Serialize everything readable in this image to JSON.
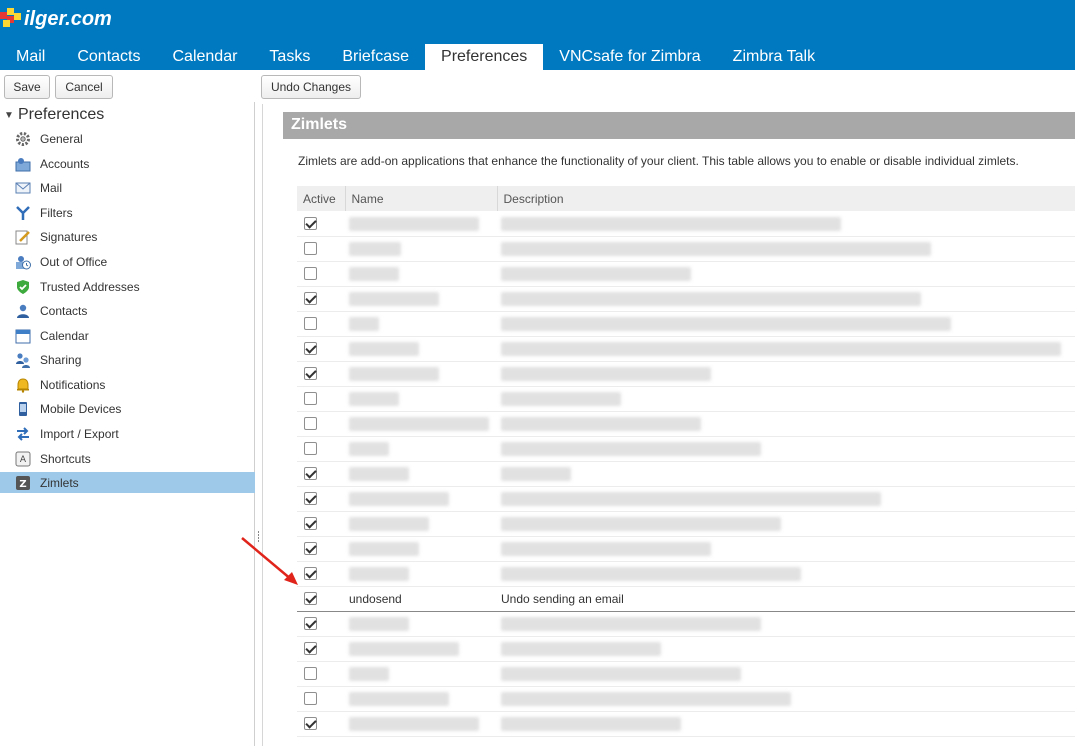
{
  "header": {
    "logo_text": "ilger.com",
    "tabs": [
      {
        "label": "Mail"
      },
      {
        "label": "Contacts"
      },
      {
        "label": "Calendar"
      },
      {
        "label": "Tasks"
      },
      {
        "label": "Briefcase"
      },
      {
        "label": "Preferences",
        "active": true
      },
      {
        "label": "VNCsafe for Zimbra"
      },
      {
        "label": "Zimbra Talk"
      }
    ]
  },
  "toolbar": {
    "save_label": "Save",
    "cancel_label": "Cancel",
    "undo_label": "Undo Changes"
  },
  "sidebar": {
    "title": "Preferences",
    "items": [
      {
        "label": "General",
        "icon": "gear-icon"
      },
      {
        "label": "Accounts",
        "icon": "accounts-icon"
      },
      {
        "label": "Mail",
        "icon": "envelope-icon"
      },
      {
        "label": "Filters",
        "icon": "filter-icon"
      },
      {
        "label": "Signatures",
        "icon": "signature-icon"
      },
      {
        "label": "Out of Office",
        "icon": "out-of-office-icon"
      },
      {
        "label": "Trusted Addresses",
        "icon": "shield-check-icon"
      },
      {
        "label": "Contacts",
        "icon": "contacts-icon"
      },
      {
        "label": "Calendar",
        "icon": "calendar-icon"
      },
      {
        "label": "Sharing",
        "icon": "sharing-icon"
      },
      {
        "label": "Notifications",
        "icon": "bell-icon"
      },
      {
        "label": "Mobile Devices",
        "icon": "mobile-icon"
      },
      {
        "label": "Import / Export",
        "icon": "import-export-icon"
      },
      {
        "label": "Shortcuts",
        "icon": "keyboard-icon"
      },
      {
        "label": "Zimlets",
        "icon": "zimlet-icon",
        "selected": true
      }
    ]
  },
  "main": {
    "section_title": "Zimlets",
    "intro": "Zimlets are add-on applications that enhance the functionality of your client. This table allows you to enable or disable individual zimlets.",
    "columns": [
      "Active",
      "Name",
      "Description"
    ],
    "rows": [
      {
        "active": true,
        "name": "",
        "description": ""
      },
      {
        "active": false,
        "name": "",
        "description": ""
      },
      {
        "active": false,
        "name": "",
        "description": ""
      },
      {
        "active": true,
        "name": "",
        "description": ""
      },
      {
        "active": false,
        "name": "",
        "description": ""
      },
      {
        "active": true,
        "name": "",
        "description": ""
      },
      {
        "active": true,
        "name": "",
        "description": ""
      },
      {
        "active": false,
        "name": "",
        "description": ""
      },
      {
        "active": false,
        "name": "",
        "description": ""
      },
      {
        "active": false,
        "name": "",
        "description": ""
      },
      {
        "active": true,
        "name": "",
        "description": ""
      },
      {
        "active": true,
        "name": "",
        "description": ""
      },
      {
        "active": true,
        "name": "",
        "description": ""
      },
      {
        "active": true,
        "name": "",
        "description": ""
      },
      {
        "active": true,
        "name": "",
        "description": ""
      },
      {
        "active": true,
        "name": "undosend",
        "description": "Undo sending an email",
        "highlighted": true
      },
      {
        "active": true,
        "name": "",
        "description": ""
      },
      {
        "active": true,
        "name": "",
        "description": ""
      },
      {
        "active": false,
        "name": "",
        "description": ""
      },
      {
        "active": false,
        "name": "",
        "description": ""
      },
      {
        "active": true,
        "name": "",
        "description": ""
      }
    ]
  },
  "colors": {
    "brand": "#0079c1",
    "selected": "#9ec9e9",
    "section_header": "#a8a8a8",
    "annotation_arrow": "#e0241b"
  }
}
